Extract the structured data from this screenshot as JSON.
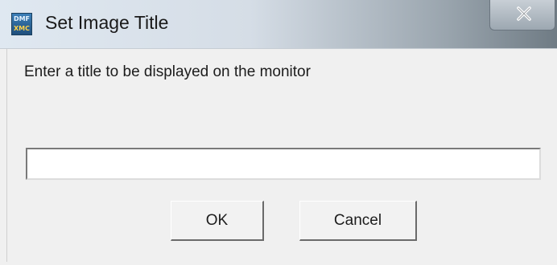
{
  "window": {
    "title": "Set Image Title",
    "icon_name": "app-icon",
    "icon_lines": [
      "DMF",
      "XMC"
    ]
  },
  "dialog": {
    "prompt": "Enter a title to be displayed on the monitor",
    "input_value": "",
    "ok_label": "OK",
    "cancel_label": "Cancel"
  },
  "colors": {
    "titlebar_start": "#dfe8f1",
    "titlebar_end": "#6f7b84",
    "body": "#f0f0f0"
  }
}
